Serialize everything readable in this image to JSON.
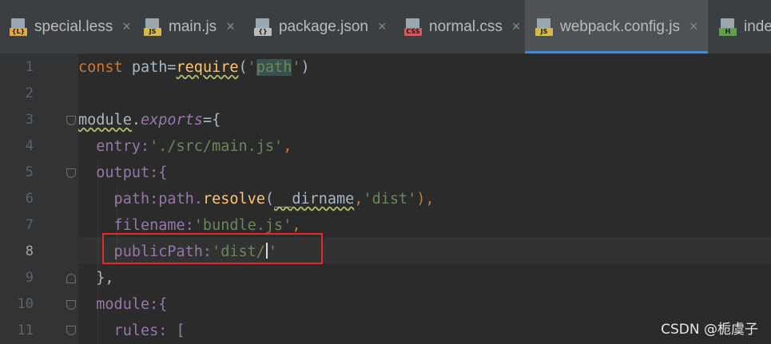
{
  "tabs": [
    {
      "label": "special.less",
      "icon": "less-file-icon",
      "badge": "{L}",
      "badge_color": "#e1a941",
      "active": false
    },
    {
      "label": "main.js",
      "icon": "js-file-icon",
      "badge": "JS",
      "badge_color": "#d6b94a",
      "active": false
    },
    {
      "label": "package.json",
      "icon": "json-file-icon",
      "badge": "{}",
      "badge_color": "#bbbbbb",
      "active": false
    },
    {
      "label": "normal.css",
      "icon": "css-file-icon",
      "badge": "CSS",
      "badge_color": "#d45b5b",
      "active": false
    },
    {
      "label": "webpack.config.js",
      "icon": "js-file-icon",
      "badge": "JS",
      "badge_color": "#d6b94a",
      "active": true
    },
    {
      "label": "inde",
      "icon": "html-file-icon",
      "badge": "H",
      "badge_color": "#62a04a",
      "active": false
    }
  ],
  "close_glyph": "×",
  "line_numbers": [
    "1",
    "2",
    "3",
    "4",
    "5",
    "6",
    "7",
    "8",
    "9",
    "10",
    "11"
  ],
  "current_line": "8",
  "code": {
    "l1": {
      "kw": "const",
      "a": " path=",
      "fn": "require",
      "b": "(",
      "q1": "'",
      "s": "path",
      "q2": "'",
      "c": ")"
    },
    "l3": {
      "a": "module",
      "b": ".",
      "c": "exports",
      "d": "={"
    },
    "l4": {
      "a": "  entry:",
      "s": "'./src/main.js'",
      "c": ","
    },
    "l5": {
      "a": "  output:{"
    },
    "l6": {
      "a": "    path:path.",
      "fn": "resolve",
      "b": "(",
      "c": "__dirname",
      "d": ",",
      "s": "'dist'",
      "e": "),"
    },
    "l7": {
      "a": "    filename:",
      "s": "'bundle.js'",
      "c": ","
    },
    "l8": {
      "a": "    publicPath:",
      "s1": "'dist/",
      "s2": "'"
    },
    "l9": {
      "a": "  },"
    },
    "l10": {
      "a": "  module:{"
    },
    "l11": {
      "a": "    rules: ["
    }
  },
  "watermark": "CSDN @栀虞子",
  "colors": {
    "keyword": "#cc7832",
    "string": "#6a8759",
    "property": "#9876aa",
    "function": "#ffc66d",
    "highlight": "#e2282b"
  }
}
